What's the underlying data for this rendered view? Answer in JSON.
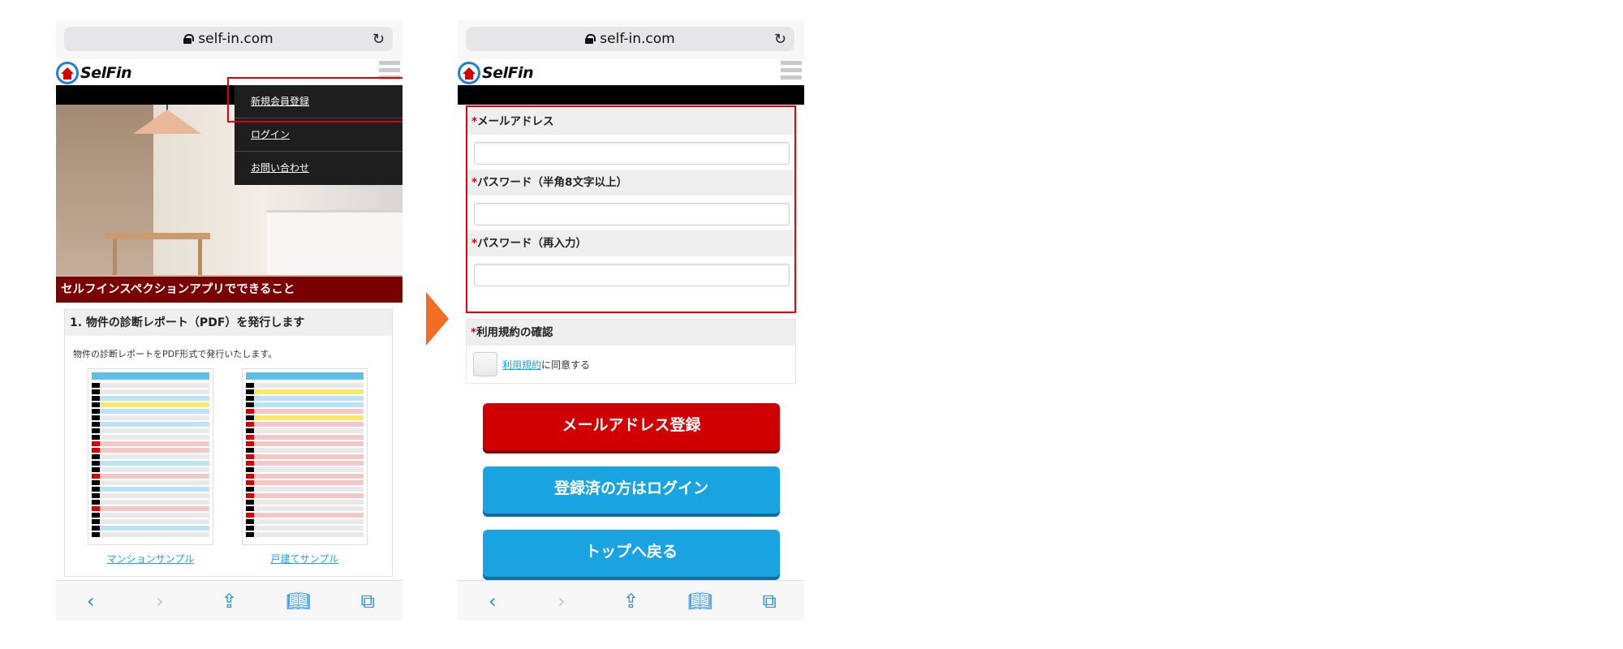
{
  "browser": {
    "url": "self-in.com"
  },
  "site": {
    "logo_text": "SelFin"
  },
  "left": {
    "menu": [
      "新規会員登録",
      "ログイン",
      "お問い合わせ"
    ],
    "hero_caption": "セルフインスペクションアプリでできること",
    "section": {
      "title": "1. 物件の診断レポート（PDF）を発行します",
      "description": "物件の診断レポートをPDF形式で発行いたします。",
      "samples": [
        "マンションサンプル",
        "戸建てサンプル"
      ]
    }
  },
  "right": {
    "form": {
      "email_label": "メールアドレス",
      "password_label": "パスワード（半角8文字以上）",
      "password_confirm_label": "パスワード（再入力）",
      "terms_label": "利用規約の確認",
      "terms_link": "利用規約",
      "terms_suffix": "に同意する",
      "required_mark": "*"
    },
    "buttons": {
      "register": "メールアドレス登録",
      "login": "登録済の方はログイン",
      "top": "トップへ戻る"
    }
  },
  "colors": {
    "accent_red": "#d10000",
    "accent_blue": "#19a3e0",
    "arrow_orange": "#f26d21",
    "highlight_red": "#e0000a"
  },
  "icons": [
    "lock-icon",
    "reload-icon",
    "back-icon",
    "forward-icon",
    "share-icon",
    "bookmarks-icon",
    "tabs-icon"
  ]
}
